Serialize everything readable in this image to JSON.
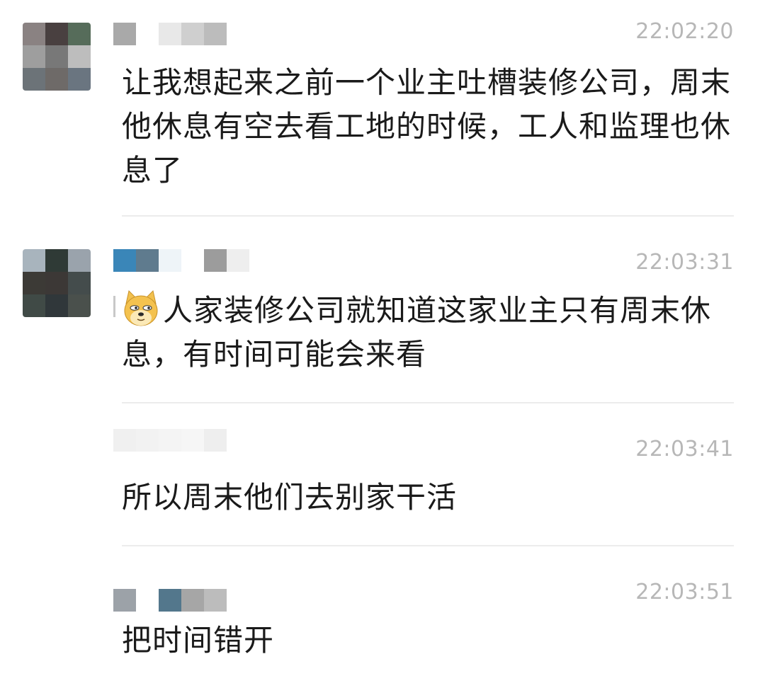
{
  "comments": [
    {
      "timestamp": "22:02:20",
      "text": "让我想起来之前一个业主吐槽装修公司，周末他休息有空去看工地的时候，工人和监理也休息了",
      "avatar_colors": [
        "#8a8282",
        "#494040",
        "#566c5a",
        "#9e9e9e",
        "#787878",
        "#bdbdbd",
        "#6c7378",
        "#6e6a68",
        "#6a7580"
      ],
      "name_colors": [
        "#a9a9a9",
        "#ffffff",
        "#e8e8e8",
        "#cfcfcf",
        "#bcbcbc",
        "#ffffff"
      ]
    },
    {
      "timestamp": "22:03:31",
      "text": "人家装修公司就知道这家业主只有周末休息，有时间可能会来看",
      "emoji": "doge-emoji",
      "avatar_colors": [
        "#a8b4bd",
        "#2f3a36",
        "#9aa3ac",
        "#3c3a36",
        "#3c3836",
        "#444c4c",
        "#404a46",
        "#30373a",
        "#4a504c"
      ],
      "name_colors": [
        "#3a86b8",
        "#5f7b8e",
        "#eef4f8",
        "#ffffff",
        "#9c9c9c",
        "#eeeeee"
      ]
    },
    {
      "timestamp": "22:03:41",
      "text": "所以周末他们去别家干活",
      "avatar_colors": [
        "#ffffff",
        "#ffffff",
        "#ffffff",
        "#ffffff",
        "#ffffff",
        "#ffffff",
        "#ffffff",
        "#ffffff",
        "#ffffff"
      ],
      "name_colors": [
        "#f0f0f0",
        "#f2f2f2",
        "#f4f4f4",
        "#f6f6f6",
        "#eeeeee",
        "#ffffff"
      ]
    },
    {
      "timestamp": "22:03:51",
      "text": "把时间错开",
      "avatar_colors": [
        "#ffffff",
        "#ffffff",
        "#ffffff",
        "#ffffff",
        "#ffffff",
        "#ffffff",
        "#ffffff",
        "#ffffff",
        "#ffffff"
      ],
      "name_colors": [
        "#9ca2a8",
        "#ffffff",
        "#53778c",
        "#a6a6a6",
        "#bcbcbc",
        "#ffffff"
      ]
    }
  ]
}
